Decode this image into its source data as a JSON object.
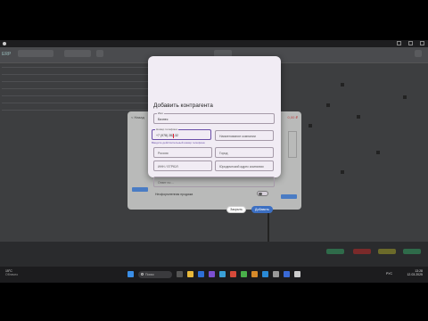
{
  "app": {
    "logo_text": "ERP"
  },
  "behind_dialog": {
    "title": "< Назад",
    "right_value": "0,00 ₽"
  },
  "modal": {
    "title": "Добавить контрагента",
    "fields": {
      "name": {
        "label": "Имя",
        "value": "Бизнес"
      },
      "phone": {
        "label": "Номер телефона",
        "value": "+7 (978) 282-32"
      },
      "phone_hint": "Введите действительный номер телефона",
      "company": {
        "placeholder": "Наименование компании"
      },
      "country": {
        "placeholder": "Россия"
      },
      "city": {
        "placeholder": "Город"
      },
      "address": {
        "placeholder": "ИНН / ЕГРЮЛ"
      },
      "legal_address": {
        "placeholder": "Юридический адрес компании"
      },
      "comment": {
        "placeholder": "Ответ по ..."
      }
    },
    "toggle_label": "Неоформленная продажа",
    "toggle_on": false,
    "cancel_label": "Закрыть",
    "add_label": "Добавить"
  },
  "taskbar": {
    "weather_temp": "15°C",
    "weather_desc": "Облачно",
    "search_placeholder": "Поиск",
    "time": "13:28",
    "date": "12.03.2025",
    "lang": "РУС"
  },
  "colors": {
    "accent": "#3c6fc2",
    "focus": "#6a4ea8"
  }
}
